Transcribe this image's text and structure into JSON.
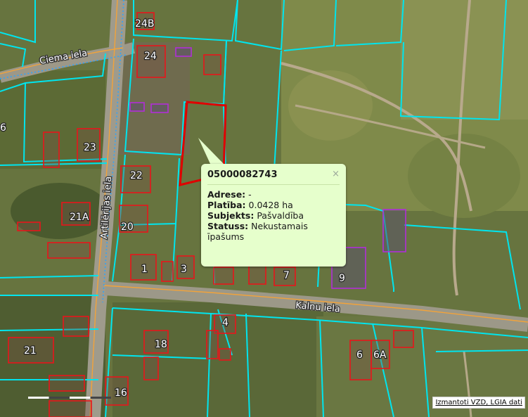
{
  "streets": {
    "ciema": "Ciema iela",
    "artilerijas": "Artilērijas iela",
    "kalnu": "Kalnu iela"
  },
  "parcel_labels": {
    "p24b": "24B",
    "p24": "24",
    "p6left": "6",
    "p23": "23",
    "p22": "22",
    "p21a": "21A",
    "p20": "20",
    "p1": "1",
    "p3": "3",
    "p7": "7",
    "p9": "9",
    "p4": "4",
    "p18": "18",
    "p21": "21",
    "p16": "16",
    "p6": "6",
    "p6a": "6A"
  },
  "popup": {
    "title": "05000082743",
    "close": "×",
    "address_label": "Adrese:",
    "address_value": "-",
    "area_label": "Platība:",
    "area_value": "0.0428 ha",
    "subject_label": "Subjekts:",
    "subject_value": "Pašvaldība",
    "status_label": "Statuss:",
    "status_value": "Nekustamais īpašums"
  },
  "attribution": "Izmantoti VZD, LGIA dati",
  "colors": {
    "parcel_boundary": "#00e5ee",
    "building_outline": "#e8151b",
    "selected_parcel": "#e00000",
    "road_centerline": "#f2a33a",
    "popup_bg": "#e6ffcc"
  }
}
